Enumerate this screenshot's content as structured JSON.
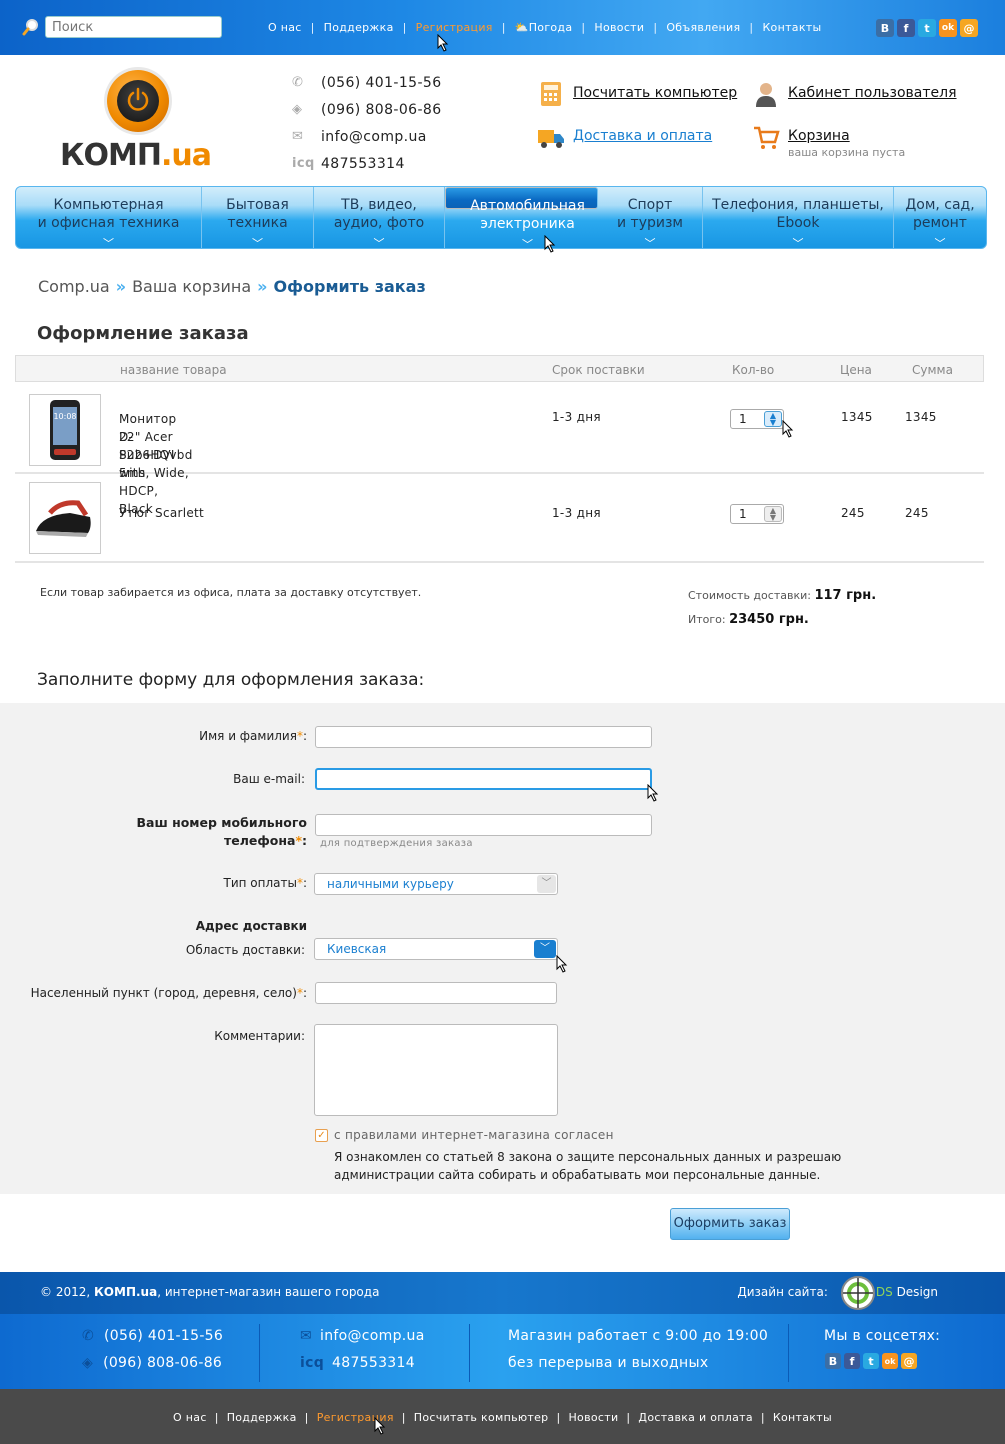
{
  "search": {
    "placeholder": "Поиск"
  },
  "topnav": [
    {
      "label": "О нас",
      "active": false
    },
    {
      "label": "Поддержка",
      "active": false
    },
    {
      "label": "Регистрация",
      "active": true
    },
    {
      "label": "Погода",
      "active": false,
      "icon": "weather-icon"
    },
    {
      "label": "Новости",
      "active": false
    },
    {
      "label": "Объявления",
      "active": false
    },
    {
      "label": "Контакты",
      "active": false
    }
  ],
  "social": [
    {
      "icon": "vk-icon",
      "glyph": "В",
      "color": "#3b6ea5"
    },
    {
      "icon": "facebook-icon",
      "glyph": "f",
      "color": "#3b5998"
    },
    {
      "icon": "twitter-icon",
      "glyph": "t",
      "color": "#29a9e1"
    },
    {
      "icon": "odnoklassniki-icon",
      "glyph": "ok",
      "color": "#f7931e"
    },
    {
      "icon": "mail-icon",
      "glyph": "@",
      "color": "#f5a623"
    }
  ],
  "logo": {
    "name": "КОМП",
    "suffix": ".ua"
  },
  "contacts": {
    "phone1": "(056) 401-15-56",
    "phone2": "(096) 808-06-86",
    "email": "info@comp.ua",
    "icq_label": "icq",
    "icq": "487553314"
  },
  "header_links": {
    "calc": "Посчитать компьютер",
    "cabinet": "Кабинет пользователя",
    "delivery": "Доставка и оплата",
    "cart": "Корзина",
    "cart_status": "ваша корзина пуста"
  },
  "mainnav": [
    {
      "line1": "Компьютерная",
      "line2": "и офисная техника",
      "selected": false
    },
    {
      "line1": "Бытовая",
      "line2": "техника",
      "selected": false
    },
    {
      "line1": "ТВ, видео,",
      "line2": "аудио, фото",
      "selected": false
    },
    {
      "line1": "Автомобильная",
      "line2": "электроника",
      "selected": true
    },
    {
      "line1": "Спорт",
      "line2": "и туризм",
      "selected": false
    },
    {
      "line1": "Телефония, планшеты,",
      "line2": "Ebook",
      "selected": false
    },
    {
      "line1": "Дом, сад,",
      "line2": "ремонт",
      "selected": false
    }
  ],
  "breadcrumb": {
    "item1": "Comp.ua",
    "item2": "Ваша корзина",
    "current": "Оформить заказ"
  },
  "order_title": "Оформление заказа",
  "cart_table": {
    "headers": {
      "name": "название товара",
      "delivery": "Срок поставки",
      "qty": "Кол-во",
      "price": "Цена",
      "sum": "Сумма"
    },
    "rows": [
      {
        "name_line1": "Монитор 22\" Acer P226HQvbd 5ms, Wide,",
        "name_line2": "D-Sub+DVI with HDCP, Black",
        "delivery": "1-3 дня",
        "qty": "1",
        "price": "1345",
        "sum": "1345",
        "thumb": "phone-image"
      },
      {
        "name_line1": "Утюг Scarlett",
        "name_line2": "",
        "delivery": "1-3 дня",
        "qty": "1",
        "price": "245",
        "sum": "245",
        "thumb": "iron-image"
      }
    ]
  },
  "delivery_note": "Если товар забирается из офиса, плата за доставку отсутствует.",
  "totals": {
    "delivery_label": "Стоимость доставки:",
    "delivery_value": "117 грн.",
    "total_label": "Итого:",
    "total_value": "23450 грн."
  },
  "form": {
    "title": "Заполните форму для оформления заказа:",
    "name_label": "Имя и фамилия",
    "email_label": "Ваш e-mail:",
    "phone_label_line1": "Ваш номер мобильного",
    "phone_label_line2": "телефона",
    "phone_hint": "для подтверждения заказа",
    "payment_label": "Тип оплаты",
    "payment_value": "наличными курьеру",
    "address_heading": "Адрес доставки",
    "region_label": "Область доставки:",
    "region_value": "Киевская",
    "city_label": "Населенный пункт (город, деревня, село)",
    "comments_label": "Комментарии:",
    "required_mark": "*",
    "agree_checked": true,
    "agree_label": "с правилами интернет-магазина согласен",
    "law_text": "Я ознакомлен со статьей 8 закона о защите персональных данных и разрешаю администрации сайта собирать и обрабатывать мои персональные данные.",
    "submit": "Оформить заказ"
  },
  "footer": {
    "copyright_year": "© 2012,",
    "copyright_brand": "КОМП.ua",
    "copyright_rest": ", интернет-магазин вашего города",
    "design_label": "Дизайн сайта:",
    "design_ds": "DS",
    "design_name": "Design",
    "phone1": "(056) 401-15-56",
    "phone2": "(096) 808-06-86",
    "email": "info@comp.ua",
    "icq_label": "icq",
    "icq": "487553314",
    "hours_line1": "Магазин работает с 9:00 до 19:00",
    "hours_line2": "без перерыва и выходных",
    "social_label": "Мы в соцсетях:",
    "nav": [
      {
        "label": "О нас",
        "active": false
      },
      {
        "label": "Поддержка",
        "active": false
      },
      {
        "label": "Регистрация",
        "active": true
      },
      {
        "label": "Посчитать компьютер",
        "active": false
      },
      {
        "label": "Новости",
        "active": false
      },
      {
        "label": "Доставка и оплата",
        "active": false
      },
      {
        "label": "Контакты",
        "active": false
      }
    ]
  }
}
